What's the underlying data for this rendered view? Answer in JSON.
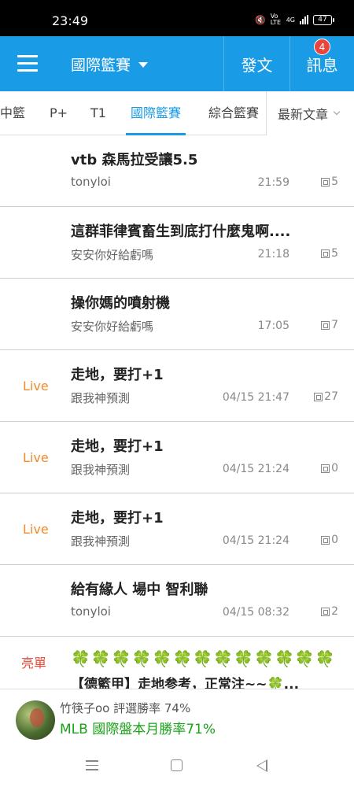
{
  "status_bar": {
    "time": "23:49",
    "network": "4G",
    "volte": "Vo LTE",
    "battery": "47"
  },
  "app_bar": {
    "board": "國際籃賽",
    "post_label": "發文",
    "messages_label": "訊息",
    "messages_badge": "4"
  },
  "tabs": {
    "items": [
      "中籃",
      "P+",
      "T1",
      "國際籃賽",
      "綜合籃賽"
    ],
    "active": "國際籃賽",
    "sort_label": "最新文章"
  },
  "posts": [
    {
      "tag": "",
      "title": "vtb 森馬拉受讓5.5",
      "author": "tonyloi",
      "time": "21:59",
      "replies": "5"
    },
    {
      "tag": "",
      "title": "這群菲律賓畜生到底打什麼鬼啊....",
      "author": "安安你好給虧嗎",
      "time": "21:18",
      "replies": "5"
    },
    {
      "tag": "",
      "title": "操你媽的噴射機",
      "author": "安安你好給虧嗎",
      "time": "17:05",
      "replies": "7"
    },
    {
      "tag": "Live",
      "title": "走地，要打+1",
      "author": "跟我神預測",
      "time": "04/15 21:47",
      "replies": "27"
    },
    {
      "tag": "Live",
      "title": "走地，要打+1",
      "author": "跟我神預測",
      "time": "04/15 21:24",
      "replies": "0"
    },
    {
      "tag": "Live",
      "title": "走地，要打+1",
      "author": "跟我神預測",
      "time": "04/15 21:24",
      "replies": "0"
    },
    {
      "tag": "",
      "title": "給有緣人 場中 智利聯",
      "author": "tonyloi",
      "time": "04/15 08:32",
      "replies": "2"
    }
  ],
  "promo": {
    "tag": "亮單",
    "clovers": "🍀🍀🍀🍀🍀🍀🍀🍀🍀🍀🍀🍀🍀",
    "text": "【德籃甲】走地参考，正常注~~🍀..."
  },
  "banner": {
    "user": "竹筷子oo  評選勝率 74%",
    "rate": "MLB 國際盤本月勝率71%"
  },
  "colors": {
    "primary": "#1a9be6",
    "live": "#f28a2a",
    "promo_tag": "#e84a3a",
    "banner_rate": "#1aa31a",
    "badge": "#e8453c"
  }
}
